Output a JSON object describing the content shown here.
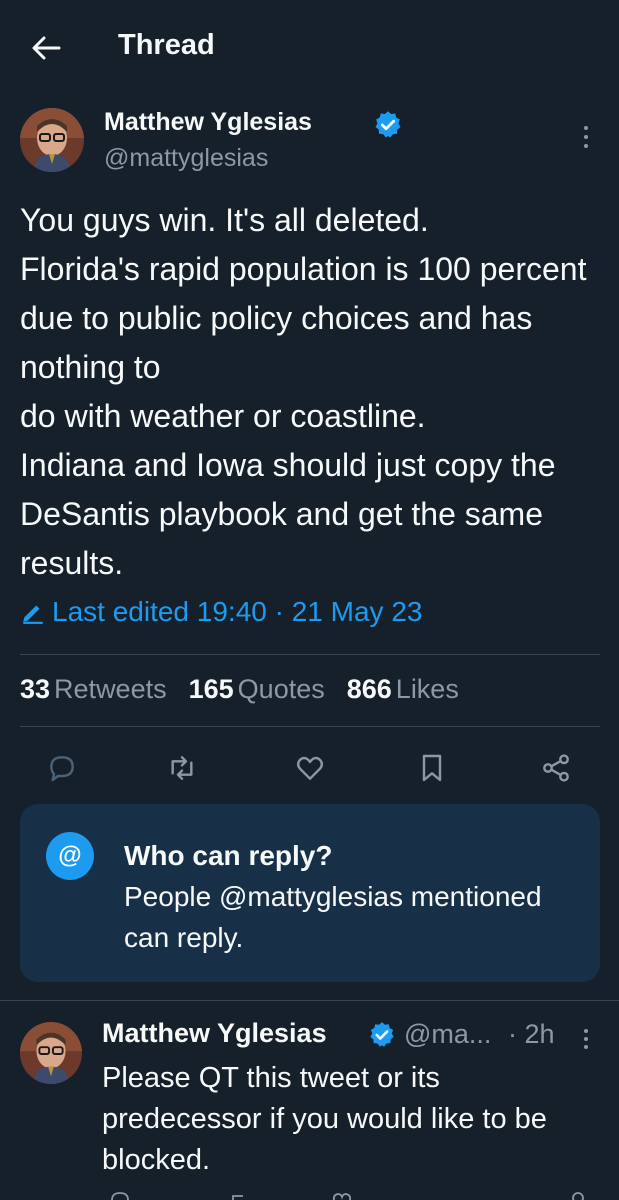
{
  "header": {
    "title": "Thread"
  },
  "tweet": {
    "author_name": "Matthew Yglesias",
    "handle": "@mattyglesias",
    "text": "You guys win. It's all deleted.\nFlorida's rapid population is 100 percent due to public policy choices and has nothing to\ndo with weather or coastline.\nIndiana and Iowa should just copy the DeSantis playbook and get the same results.",
    "edited_label": "Last edited 19:40 · 21 May 23",
    "stats": {
      "retweets_count": "33",
      "retweets_label": "Retweets",
      "quotes_count": "165",
      "quotes_label": "Quotes",
      "likes_count": "866",
      "likes_label": "Likes"
    }
  },
  "reply_restriction": {
    "icon": "@",
    "title": "Who can reply?",
    "body": "People @mattyglesias mentioned can reply."
  },
  "reply_tweet": {
    "author_name": "Matthew Yglesias",
    "handle": "@ma...",
    "time": "· 2h",
    "text": "Please QT this tweet or its predecessor if you would like to be blocked."
  },
  "colors": {
    "background": "#15202b",
    "accent": "#1d9bf0",
    "muted_text": "#8b98a5",
    "divider": "#38444d",
    "reply_box": "#173047"
  }
}
